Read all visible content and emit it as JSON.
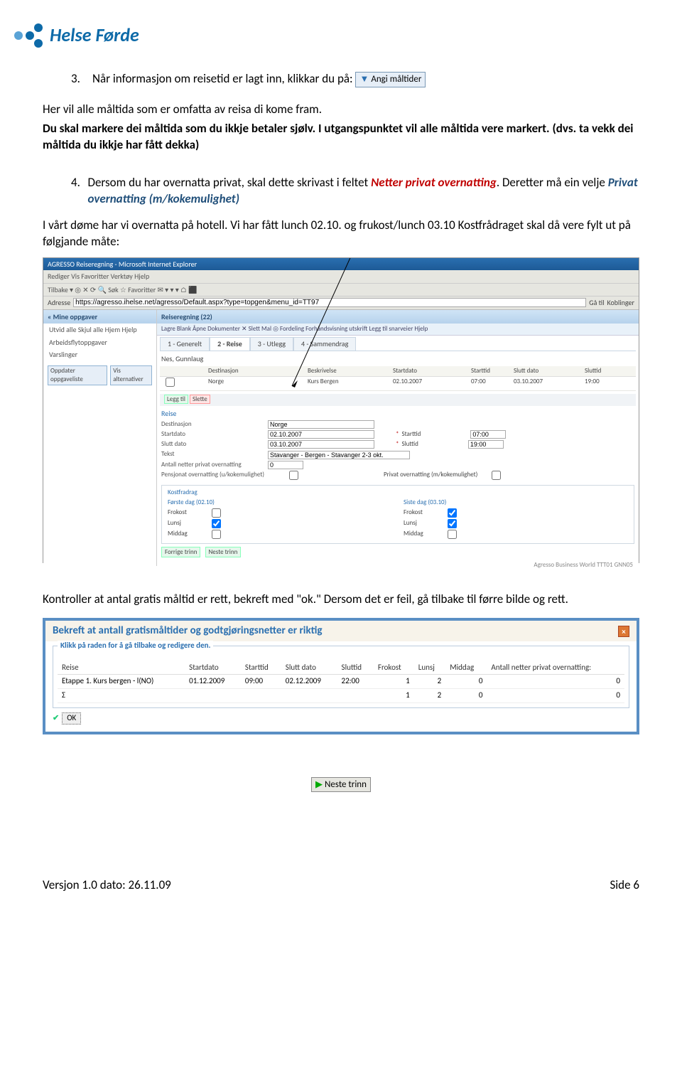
{
  "logo_text": "Helse Førde",
  "section3_num": "3.",
  "section3_text": "Når informasjon om reisetid er lagt inn, klikkar du på:",
  "button_angi": "Angi måltider",
  "p1": "Her vil alle måltida som er omfatta av reisa di kome fram.",
  "p2": "Du skal markere dei måltida som du ikkje betaler sjølv. I utgangspunktet vil alle måltida vere markert. (dvs. ta vekk dei måltida du ikkje har fått dekka)",
  "section4_num": "4.",
  "section4_a": "Dersom du har overnatta privat, skal dette skrivast i feltet ",
  "section4_red": "Netter privat overnatting",
  "section4_b": ". Deretter må ein velje ",
  "section4_blue": "Privat overnatting (m/kokemulighet)",
  "p3": "I vårt døme har vi overnatta på hotell. Vi har fått lunch 02.10. og frukost/lunch 03.10 Kostfrådraget skal då vere fylt ut på følgjande måte:",
  "ie": {
    "title": "AGRESSO Reiseregning - Microsoft Internet Explorer",
    "menu": "Rediger  Vis  Favoritter  Verktøy  Hjelp",
    "toolbar": "Tilbake ▾  ◎  ✕  ⟳  🔍 Søk  ☆ Favoritter  ✉  ▾ ▾ ▾  ⌂ ⬛",
    "addr_label": "Adresse",
    "url": "https://agresso.ihelse.net/agresso/Default.aspx?type=topgen&menu_id=TT97",
    "go": "Gå til",
    "koblinger": "Koblinger"
  },
  "leftpane": {
    "header": "« Mine oppgaver",
    "item1": "Utvid alle  Skjul alle  Hjem  Hjelp",
    "item2": "Arbeidsflytoppgaver",
    "item3": "Varslinger",
    "btn1": "Oppdater oppgaveliste",
    "btn2": "Vis alternativer"
  },
  "rightpane": {
    "header": "Reiseregning (22)",
    "toolbar": "Lagre  Blank  Åpne  Dokumenter  ✕ Slett    Mal  ◎ Fordeling    Forhåndsvisning utskrift    Legg til snarveier   Hjelp",
    "tabs": [
      "1 - Generelt",
      "2 - Reise",
      "3 - Utlegg",
      "4 - Sammendrag"
    ],
    "name": "Nes, Gunnlaug",
    "grid_headers": [
      "",
      "Destinasjon",
      "Beskrivelse",
      "Startdato",
      "Starttid",
      "Slutt dato",
      "Sluttid"
    ],
    "row": {
      "dest": "Norge",
      "besk": "Kurs Bergen",
      "sd": "02.10.2007",
      "st": "07:00",
      "ed": "03.10.2007",
      "et": "19:00"
    },
    "leggtil": "Legg til",
    "slette": "Slette",
    "reise_hdr": "Reise",
    "f": {
      "dest": "Destinasjon",
      "dest_v": "Norge",
      "startd": "Startdato",
      "startd_v": "02.10.2007",
      "startt_l": "Starttid",
      "startt_v": "07:00",
      "sluttd": "Slutt dato",
      "sluttd_v": "03.10.2007",
      "sluttt_l": "Sluttid",
      "sluttt_v": "19:00",
      "tekst": "Tekst",
      "tekst_v": "Stavanger - Bergen - Stavanger 2-3 okt.",
      "antall": "Antall netter privat overnatting",
      "antall_v": "0",
      "pens": "Pensjonat overnatting (u/kokemulighet)",
      "priv": "Privat overnatting (m/kokemulighet)"
    },
    "kost": {
      "title": "Kostfradrag",
      "first": "Første dag (02.10)",
      "last": "Siste dag (03.10)",
      "frokost": "Frokost",
      "lunsj": "Lunsj",
      "middag": "Middag"
    },
    "forrige": "Forrige trinn",
    "neste": "Neste trinn",
    "footer": "Agresso Business World  TTT01  GNN05"
  },
  "p4a": "Kontroller at antal gratis måltid er rett, bekreft med \"ok.\" Dersom det er feil, gå tilbake til førre bilde og rett.",
  "dialog": {
    "title": "Bekreft at antall gratismåltider og godtgjøringsnetter er riktig",
    "legend": "Klikk på raden for å gå tilbake og redigere den.",
    "headers": [
      "Reise",
      "Startdato",
      "Starttid",
      "Slutt dato",
      "Sluttid",
      "Frokost",
      "Lunsj",
      "Middag",
      "Antall netter privat overnatting:"
    ],
    "row": [
      "Etappe 1. Kurs bergen - l(NO)",
      "01.12.2009",
      "09:00",
      "02.12.2009",
      "22:00",
      "1",
      "2",
      "0",
      "0"
    ],
    "sum": [
      "Σ",
      "",
      "",
      "",
      "",
      "1",
      "2",
      "0",
      "0"
    ],
    "ok": "OK"
  },
  "neste_trinn": "Neste trinn",
  "footer_left": "Versjon 1.0    dato: 26.11.09",
  "footer_right": "Side 6"
}
